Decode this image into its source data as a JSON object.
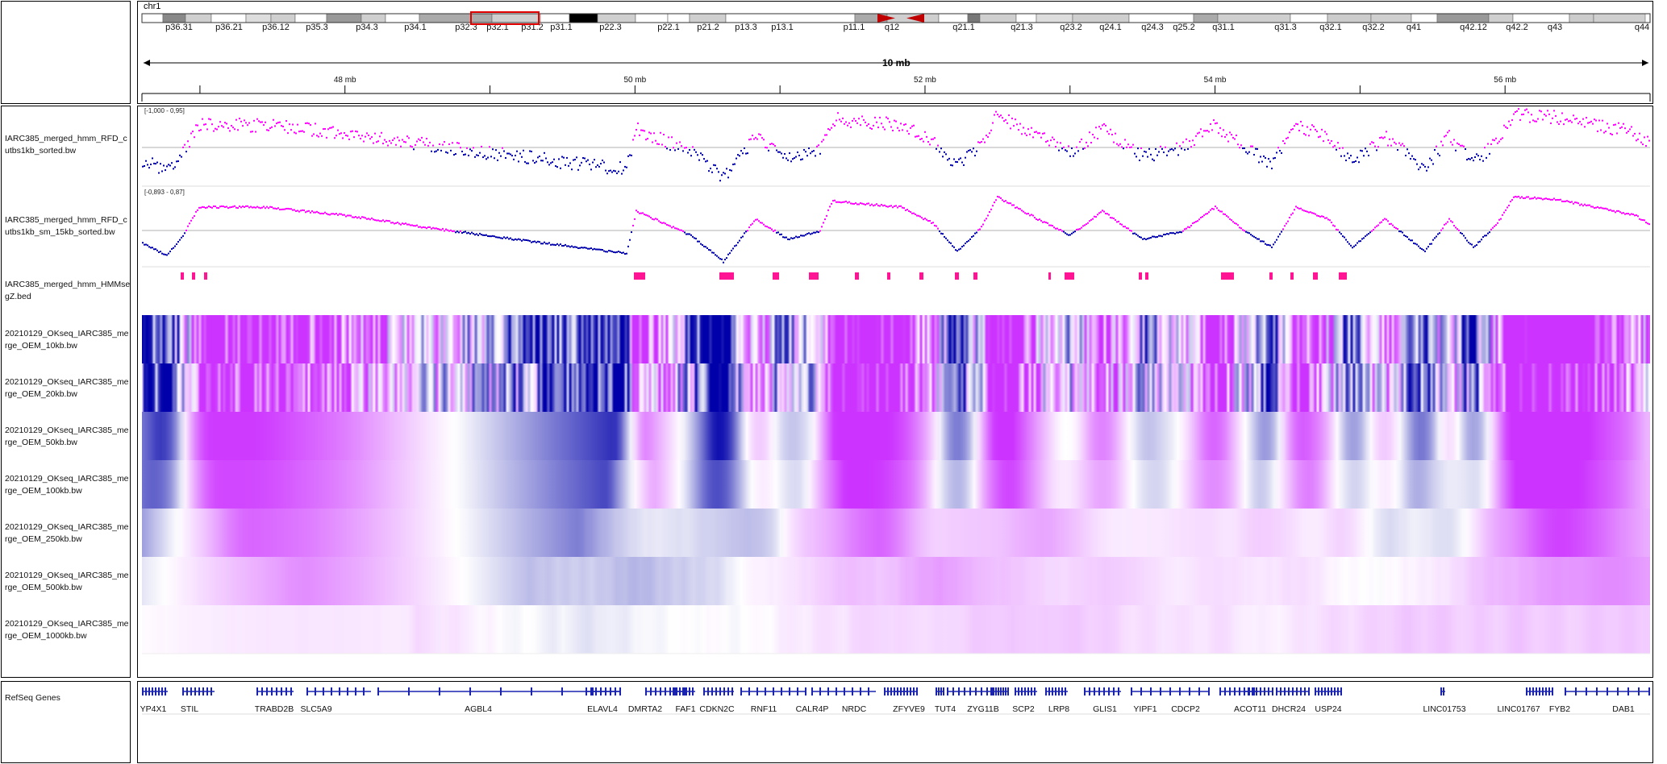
{
  "chromosome": "chr1",
  "span_label": "10 mb",
  "ideogram_bands": [
    {
      "label": "p36.31",
      "shade": "#bbbbbb"
    },
    {
      "label": "p36.21",
      "shade": "#888888"
    },
    {
      "label": "p36.12",
      "shade": "#999999"
    },
    {
      "label": "p35.3",
      "shade": "#aaaaaa"
    },
    {
      "label": "p34.3",
      "shade": "#dddddd"
    },
    {
      "label": "p34.1",
      "shade": "#cccccc"
    },
    {
      "label": "p32.3",
      "shade": "#555555"
    },
    {
      "label": "p32.1",
      "shade": "#999999"
    },
    {
      "label": "p31.2",
      "shade": "#777777"
    },
    {
      "label": "p31.1",
      "shade": "#000000"
    },
    {
      "label": "p22.3",
      "shade": "#aaaaaa"
    },
    {
      "label": "p22.1",
      "shade": "#333333"
    },
    {
      "label": "p21.2",
      "shade": "#555555"
    },
    {
      "label": "p13.3",
      "shade": "#000000"
    },
    {
      "label": "p13.1",
      "shade": "#999999"
    },
    {
      "label": "p11.1",
      "shade": "#888888"
    },
    {
      "label": "q12",
      "shade": "#ffffff"
    },
    {
      "label": "q21.1",
      "shade": "#888888"
    },
    {
      "label": "q21.3",
      "shade": "#666666"
    },
    {
      "label": "q23.2",
      "shade": "#aaaaaa"
    },
    {
      "label": "q24.1",
      "shade": "#777777"
    },
    {
      "label": "q24.3",
      "shade": "#444444"
    },
    {
      "label": "q25.2",
      "shade": "#777777"
    },
    {
      "label": "q31.1",
      "shade": "#000000"
    },
    {
      "label": "q31.3",
      "shade": "#000000"
    },
    {
      "label": "q32.1",
      "shade": "#dddddd"
    },
    {
      "label": "q32.2",
      "shade": "#aaaaaa"
    },
    {
      "label": "q41",
      "shade": "#000000"
    },
    {
      "label": "q42.12",
      "shade": "#aaaaaa"
    },
    {
      "label": "q42.2",
      "shade": "#888888"
    },
    {
      "label": "q43",
      "shade": "#444444"
    },
    {
      "label": "q44",
      "shade": "#cccccc"
    }
  ],
  "ruler": {
    "ticks": [
      "48 mb",
      "50 mb",
      "52 mb",
      "54 mb",
      "56 mb"
    ],
    "mb_start": 46.6,
    "mb_end": 57.0
  },
  "tracks": {
    "rfd_1kb": {
      "name": "IARC385_merged_hmm_RFD_cutbs1kb_sorted.bw",
      "range": "[-1,000 - 0,95]"
    },
    "rfd_15kb": {
      "name": "IARC385_merged_hmm_RFD_cutbs1kb_sm_15kb_sorted.bw",
      "range": "[-0,893 - 0,87]"
    },
    "hmmseg": {
      "name": "IARC385_merged_hmm_HMMsegZ.bed"
    },
    "oem": [
      {
        "name": "20210129_OKseq_IARC385_merge_OEM_10kb.bw"
      },
      {
        "name": "20210129_OKseq_IARC385_merge_OEM_20kb.bw"
      },
      {
        "name": "20210129_OKseq_IARC385_merge_OEM_50kb.bw"
      },
      {
        "name": "20210129_OKseq_IARC385_merge_OEM_100kb.bw"
      },
      {
        "name": "20210129_OKseq_IARC385_merge_OEM_250kb.bw"
      },
      {
        "name": "20210129_OKseq_IARC385_merge_OEM_500kb.bw"
      },
      {
        "name": "20210129_OKseq_IARC385_merge_OEM_1000kb.bw"
      }
    ],
    "genes": {
      "name": "RefSeq Genes"
    }
  },
  "genes": [
    "YP4X1",
    "STIL",
    "TRABD2B",
    "SLC5A9",
    "AGBL4",
    "ELAVL4",
    "DMRTA2",
    "FAF1",
    "CDKN2C",
    "RNF11",
    "CALR4P",
    "NRDC",
    "ZFYVE9",
    "TUT4",
    "ZYG11B",
    "SCP2",
    "LRP8",
    "GLIS1",
    "YIPF1",
    "CDCP2",
    "ACOT11",
    "DHCR24",
    "USP24",
    "LINC01753",
    "LINC01767",
    "FYB2",
    "DAB1"
  ],
  "colors": {
    "forward": "#ff00ff",
    "reverse": "#0000aa",
    "segment": "#ff1493",
    "gene": "#1a23b0",
    "heat_high": "#cc33ff",
    "heat_low": "#0000aa"
  }
}
